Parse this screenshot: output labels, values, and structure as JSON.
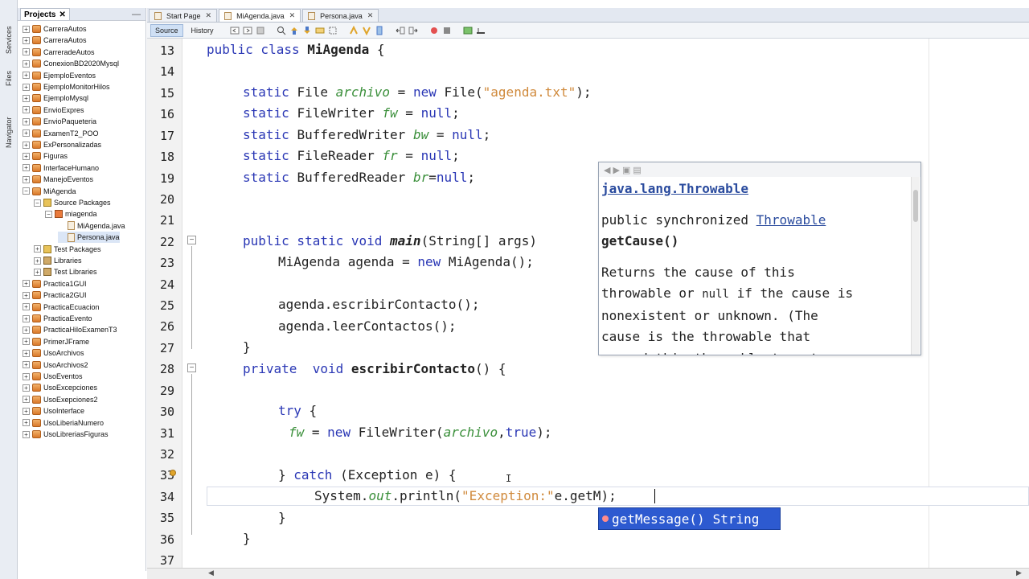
{
  "side_tabs": [
    "Services",
    "Files",
    "Navigator"
  ],
  "projects_panel": {
    "title": "Projects",
    "items": [
      {
        "label": "CarreraAutos",
        "type": "project",
        "level": 0,
        "expanded": false
      },
      {
        "label": "CarreraAutos",
        "type": "project",
        "level": 0,
        "expanded": false
      },
      {
        "label": "CarreradeAutos",
        "type": "project",
        "level": 0,
        "expanded": false
      },
      {
        "label": "ConexionBD2020Mysql",
        "type": "project",
        "level": 0,
        "expanded": false
      },
      {
        "label": "EjemploEventos",
        "type": "project",
        "level": 0,
        "expanded": false
      },
      {
        "label": "EjemploMonitorHilos",
        "type": "project",
        "level": 0,
        "expanded": false
      },
      {
        "label": "EjemploMysql",
        "type": "project",
        "level": 0,
        "expanded": false
      },
      {
        "label": "EnvioExpres",
        "type": "project",
        "level": 0,
        "expanded": false
      },
      {
        "label": "EnvioPaqueteria",
        "type": "project",
        "level": 0,
        "expanded": false
      },
      {
        "label": "ExamenT2_POO",
        "type": "project",
        "level": 0,
        "expanded": false
      },
      {
        "label": "ExPersonalizadas",
        "type": "project",
        "level": 0,
        "expanded": false
      },
      {
        "label": "Figuras",
        "type": "project",
        "level": 0,
        "expanded": false
      },
      {
        "label": "InterfaceHumano",
        "type": "project",
        "level": 0,
        "expanded": false
      },
      {
        "label": "ManejoEventos",
        "type": "project",
        "level": 0,
        "expanded": false
      },
      {
        "label": "MiAgenda",
        "type": "project",
        "level": 0,
        "expanded": true
      },
      {
        "label": "Source Packages",
        "type": "package",
        "level": 1,
        "expanded": true
      },
      {
        "label": "miagenda",
        "type": "pkgsel",
        "level": 2,
        "expanded": true
      },
      {
        "label": "MiAgenda.java",
        "type": "file",
        "level": 3,
        "expanded": null
      },
      {
        "label": "Persona.java",
        "type": "file",
        "level": 3,
        "expanded": null,
        "selected": true
      },
      {
        "label": "Test Packages",
        "type": "package",
        "level": 1,
        "expanded": false
      },
      {
        "label": "Libraries",
        "type": "lib",
        "level": 1,
        "expanded": false
      },
      {
        "label": "Test Libraries",
        "type": "lib",
        "level": 1,
        "expanded": false
      },
      {
        "label": "Practica1GUI",
        "type": "project",
        "level": 0,
        "expanded": false
      },
      {
        "label": "Practica2GUI",
        "type": "project",
        "level": 0,
        "expanded": false
      },
      {
        "label": "PracticaEcuacion",
        "type": "project",
        "level": 0,
        "expanded": false
      },
      {
        "label": "PracticaEvento",
        "type": "project",
        "level": 0,
        "expanded": false
      },
      {
        "label": "PracticaHiloExamenT3",
        "type": "project",
        "level": 0,
        "expanded": false
      },
      {
        "label": "PrimerJFrame",
        "type": "project",
        "level": 0,
        "expanded": false
      },
      {
        "label": "UsoArchivos",
        "type": "project",
        "level": 0,
        "expanded": false
      },
      {
        "label": "UsoArchivos2",
        "type": "project",
        "level": 0,
        "expanded": false
      },
      {
        "label": "UsoEventos",
        "type": "project",
        "level": 0,
        "expanded": false
      },
      {
        "label": "UsoExcepciones",
        "type": "project",
        "level": 0,
        "expanded": false
      },
      {
        "label": "UsoExepciones2",
        "type": "project",
        "level": 0,
        "expanded": false
      },
      {
        "label": "UsoInterface",
        "type": "project",
        "level": 0,
        "expanded": false
      },
      {
        "label": "UsoLiberiaNumero",
        "type": "project",
        "level": 0,
        "expanded": false
      },
      {
        "label": "UsoLibreriasFiguras",
        "type": "project",
        "level": 0,
        "expanded": false
      }
    ]
  },
  "editor_tabs": [
    {
      "label": "Start Page",
      "active": false
    },
    {
      "label": "MiAgenda.java",
      "active": true
    },
    {
      "label": "Persona.java",
      "active": false
    }
  ],
  "toolbar": {
    "source_label": "Source",
    "history_label": "History"
  },
  "line_numbers": [
    "13",
    "14",
    "15",
    "16",
    "17",
    "18",
    "19",
    "20",
    "21",
    "22",
    "23",
    "24",
    "25",
    "26",
    "27",
    "28",
    "29",
    "30",
    "31",
    "32",
    "33",
    "34",
    "35",
    "36",
    "37"
  ],
  "code": {
    "l13": {
      "a": "public class ",
      "b": "MiAgenda",
      "c": " {"
    },
    "l15": {
      "a": "static ",
      "b": "File ",
      "c": "archivo",
      "d": " = ",
      "e": "new ",
      "f": "File(",
      "g": "\"agenda.txt\"",
      "h": ");"
    },
    "l16": {
      "a": "static ",
      "b": "FileWriter ",
      "c": "fw",
      "d": " = ",
      "e": "null",
      "f": ";"
    },
    "l17": {
      "a": "static ",
      "b": "BufferedWriter ",
      "c": "bw",
      "d": " = ",
      "e": "null",
      "f": ";"
    },
    "l18": {
      "a": "static ",
      "b": "FileReader ",
      "c": "fr",
      "d": " = ",
      "e": "null",
      "f": ";"
    },
    "l19": {
      "a": "static ",
      "b": "BufferedReader ",
      "c": "br",
      "d": "=",
      "e": "null",
      "f": ";"
    },
    "l22": {
      "a": "public static void ",
      "b": "main",
      "c": "(String[] args)"
    },
    "l23": {
      "a": "MiAgenda agenda = ",
      "b": "new ",
      "c": "MiAgenda();"
    },
    "l25": {
      "a": "agenda.escribirContacto();"
    },
    "l26": {
      "a": "agenda.leerContactos();"
    },
    "l27": {
      "a": "}"
    },
    "l28": {
      "a": "private  void ",
      "b": "escribirContacto",
      "c": "() {"
    },
    "l30": {
      "a": "try ",
      "b": "{"
    },
    "l31": {
      "a": "fw",
      "b": " = ",
      "c": "new ",
      "d": "FileWriter(",
      "e": "archivo",
      "f": ",",
      "g": "true",
      "h": ");"
    },
    "l33": {
      "a": "} ",
      "b": "catch ",
      "c": "(Exception e) {"
    },
    "l34": {
      "a": "System.",
      "b": "out",
      "c": ".println(",
      "d": "\"Exception:\"",
      "e": "e.getM)",
      "f": ";"
    },
    "l35": {
      "a": "}"
    },
    "l36": {
      "a": "}"
    }
  },
  "javadoc": {
    "class_link": "java.lang.Throwable",
    "signature_prefix": "public synchronized ",
    "signature_type": "Throwable",
    "method": "getCause()",
    "desc_1": "Returns the cause of this",
    "desc_2a": "throwable or ",
    "desc_2b": "null",
    "desc_2c": " if the cause is",
    "desc_3": "nonexistent or unknown. (The",
    "desc_4": "cause is the throwable that",
    "desc_5": "caused this throwable to get"
  },
  "completion": {
    "item_name": "getMessage()",
    "item_type": "String"
  },
  "colors": {
    "keyword": "#2a37b5",
    "string": "#d08a3c",
    "field": "#3a8f3a",
    "completion_bg": "#2d5ad0"
  }
}
